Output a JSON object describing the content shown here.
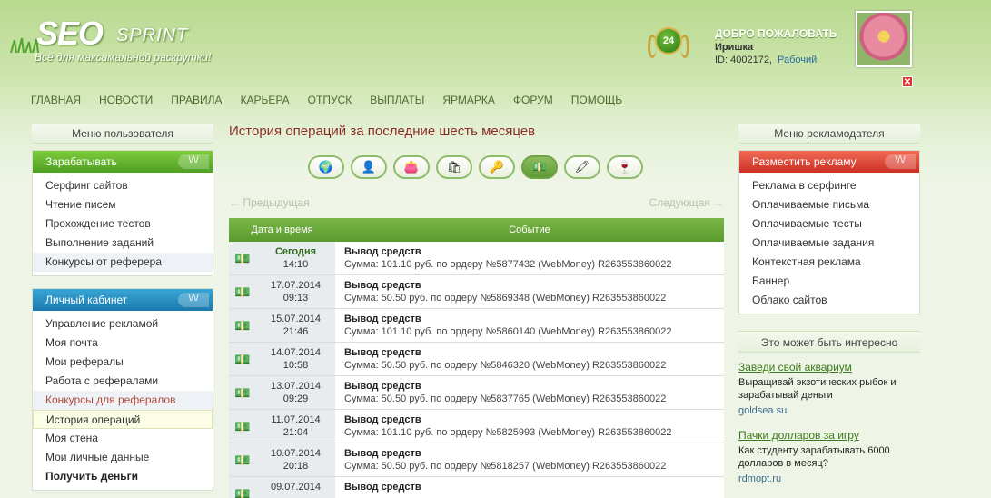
{
  "header": {
    "logo_seo": "SEO",
    "logo_sprint": "SPRINT",
    "tagline": "Всё для максимальной раскрутки!",
    "level": "24",
    "welcome": "ДОБРО ПОЖАЛОВАТЬ",
    "user_name": "Иришка",
    "user_id": "ID: 4002172,",
    "user_status": "Рабочий",
    "close": "✕"
  },
  "nav": [
    "ГЛАВНАЯ",
    "НОВОСТИ",
    "ПРАВИЛА",
    "КАРЬЕРА",
    "ОТПУСК",
    "ВЫПЛАТЫ",
    "ЯРМАРКА",
    "ФОРУМ",
    "ПОМОЩЬ"
  ],
  "left": {
    "menu_title": "Меню пользователя",
    "earn": {
      "title": "Зарабатывать",
      "items": [
        "Серфинг сайтов",
        "Чтение писем",
        "Прохождение тестов",
        "Выполнение заданий",
        "Конкурсы от реферера"
      ]
    },
    "cabinet": {
      "title": "Личный кабинет",
      "items": [
        "Управление рекламой",
        "Моя почта",
        "Мои рефералы",
        "Работа с рефералами",
        "Конкурсы для рефералов",
        "История операций",
        "Моя стена",
        "Мои личные данные",
        "Получить деньги"
      ]
    }
  },
  "center": {
    "title": "История операций за последние шесть месяцев",
    "prev": "← Предыдущая",
    "next": "Следующая →",
    "col_date": "Дата и время",
    "col_event": "Событие",
    "rows": [
      {
        "date": "Сегодня",
        "time": "14:10",
        "title": "Вывод средств",
        "desc": "Сумма: 101.10 руб. по ордеру №5877432 (WebMoney) R263553860022",
        "today": true
      },
      {
        "date": "17.07.2014",
        "time": "09:13",
        "title": "Вывод средств",
        "desc": "Сумма: 50.50 руб. по ордеру №5869348 (WebMoney) R263553860022"
      },
      {
        "date": "15.07.2014",
        "time": "21:46",
        "title": "Вывод средств",
        "desc": "Сумма: 101.10 руб. по ордеру №5860140 (WebMoney) R263553860022"
      },
      {
        "date": "14.07.2014",
        "time": "10:58",
        "title": "Вывод средств",
        "desc": "Сумма: 50.50 руб. по ордеру №5846320 (WebMoney) R263553860022"
      },
      {
        "date": "13.07.2014",
        "time": "09:29",
        "title": "Вывод средств",
        "desc": "Сумма: 50.50 руб. по ордеру №5837765 (WebMoney) R263553860022"
      },
      {
        "date": "11.07.2014",
        "time": "21:04",
        "title": "Вывод средств",
        "desc": "Сумма: 101.10 руб. по ордеру №5825993 (WebMoney) R263553860022"
      },
      {
        "date": "10.07.2014",
        "time": "20:18",
        "title": "Вывод средств",
        "desc": "Сумма: 50.50 руб. по ордеру №5818257 (WebMoney) R263553860022"
      },
      {
        "date": "09.07.2014",
        "time": "",
        "title": "Вывод средств",
        "desc": ""
      }
    ]
  },
  "right": {
    "menu_title": "Меню рекламодателя",
    "place": {
      "title": "Разместить рекламу",
      "items": [
        "Реклама в серфинге",
        "Оплачиваемые письма",
        "Оплачиваемые тесты",
        "Оплачиваемые задания",
        "Контекстная реклама",
        "Баннер",
        "Облако сайтов"
      ]
    },
    "interest_title": "Это может быть интересно",
    "ads": [
      {
        "title": "Заведи свой аквариум",
        "text": "Выращивай экзотических рыбок и зарабатывай деньги",
        "url": "goldsea.su"
      },
      {
        "title": "Пачки долларов за игру",
        "text": "Как студенту зарабатывать 6000 долларов в месяц?",
        "url": "rdmopt.ru"
      }
    ]
  },
  "toggle": "\\/\\/"
}
